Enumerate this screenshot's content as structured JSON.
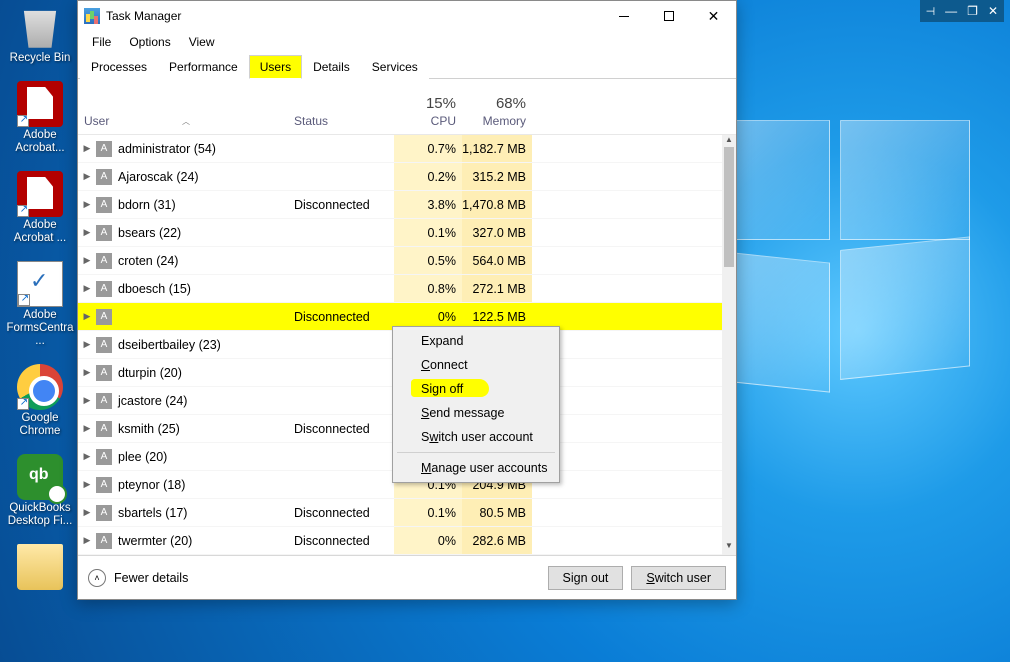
{
  "desktop": {
    "icons": [
      {
        "name": "recycle-bin",
        "label": "Recycle Bin"
      },
      {
        "name": "acrobat-1",
        "label": "Adobe Acrobat..."
      },
      {
        "name": "acrobat-2",
        "label": "Adobe Acrobat ..."
      },
      {
        "name": "forms",
        "label": "Adobe FormsCentra..."
      },
      {
        "name": "chrome",
        "label": "Google Chrome"
      },
      {
        "name": "quickbooks",
        "label": "QuickBooks Desktop Fi..."
      }
    ]
  },
  "systray": {
    "minimize": "—",
    "restore": "❐",
    "close": "✕",
    "pin": "⊣"
  },
  "window": {
    "title": "Task Manager",
    "menu": [
      "File",
      "Options",
      "View"
    ],
    "tabs": [
      "Processes",
      "Performance",
      "Users",
      "Details",
      "Services"
    ],
    "active_tab": "Users",
    "columns": {
      "user": "User",
      "status": "Status",
      "cpu_label": "CPU",
      "cpu_pct": "15%",
      "mem_label": "Memory",
      "mem_pct": "68%"
    },
    "rows": [
      {
        "name": "administrator (54)",
        "status": "",
        "cpu": "0.7%",
        "mem": "1,182.7 MB"
      },
      {
        "name": "Ajaroscak (24)",
        "status": "",
        "cpu": "0.2%",
        "mem": "315.2 MB"
      },
      {
        "name": "bdorn (31)",
        "status": "Disconnected",
        "cpu": "3.8%",
        "mem": "1,470.8 MB"
      },
      {
        "name": "bsears (22)",
        "status": "",
        "cpu": "0.1%",
        "mem": "327.0 MB"
      },
      {
        "name": "croten (24)",
        "status": "",
        "cpu": "0.5%",
        "mem": "564.0 MB"
      },
      {
        "name": "dboesch (15)",
        "status": "",
        "cpu": "0.8%",
        "mem": "272.1 MB"
      },
      {
        "name": "",
        "status": "Disconnected",
        "cpu": "0%",
        "mem": "122.5 MB",
        "highlighted": true,
        "redacted": true
      },
      {
        "name": "dseibertbailey (23)",
        "status": "",
        "cpu": "",
        "mem": ""
      },
      {
        "name": "dturpin (20)",
        "status": "",
        "cpu": "",
        "mem": ""
      },
      {
        "name": "jcastore (24)",
        "status": "",
        "cpu": "",
        "mem": ""
      },
      {
        "name": "ksmith (25)",
        "status": "Disconnected",
        "cpu": "",
        "mem": ""
      },
      {
        "name": "plee (20)",
        "status": "",
        "cpu": "",
        "mem": ""
      },
      {
        "name": "pteynor (18)",
        "status": "",
        "cpu": "0.1%",
        "mem": "204.9 MB"
      },
      {
        "name": "sbartels (17)",
        "status": "Disconnected",
        "cpu": "0.1%",
        "mem": "80.5 MB"
      },
      {
        "name": "twermter (20)",
        "status": "Disconnected",
        "cpu": "0%",
        "mem": "282.6 MB"
      }
    ],
    "footer": {
      "fewer": "Fewer details",
      "signout": "Sign out",
      "switch": "Switch user"
    }
  },
  "context_menu": {
    "items": [
      {
        "label": "Expand"
      },
      {
        "label": "Connect",
        "ul": "C"
      },
      {
        "label": "Sign off",
        "ul": "g",
        "hl": true
      },
      {
        "label": "Send message",
        "ul": "S"
      },
      {
        "label": "Switch user account",
        "ul": "w"
      },
      {
        "sep": true
      },
      {
        "label": "Manage user accounts",
        "ul": "M"
      }
    ]
  }
}
